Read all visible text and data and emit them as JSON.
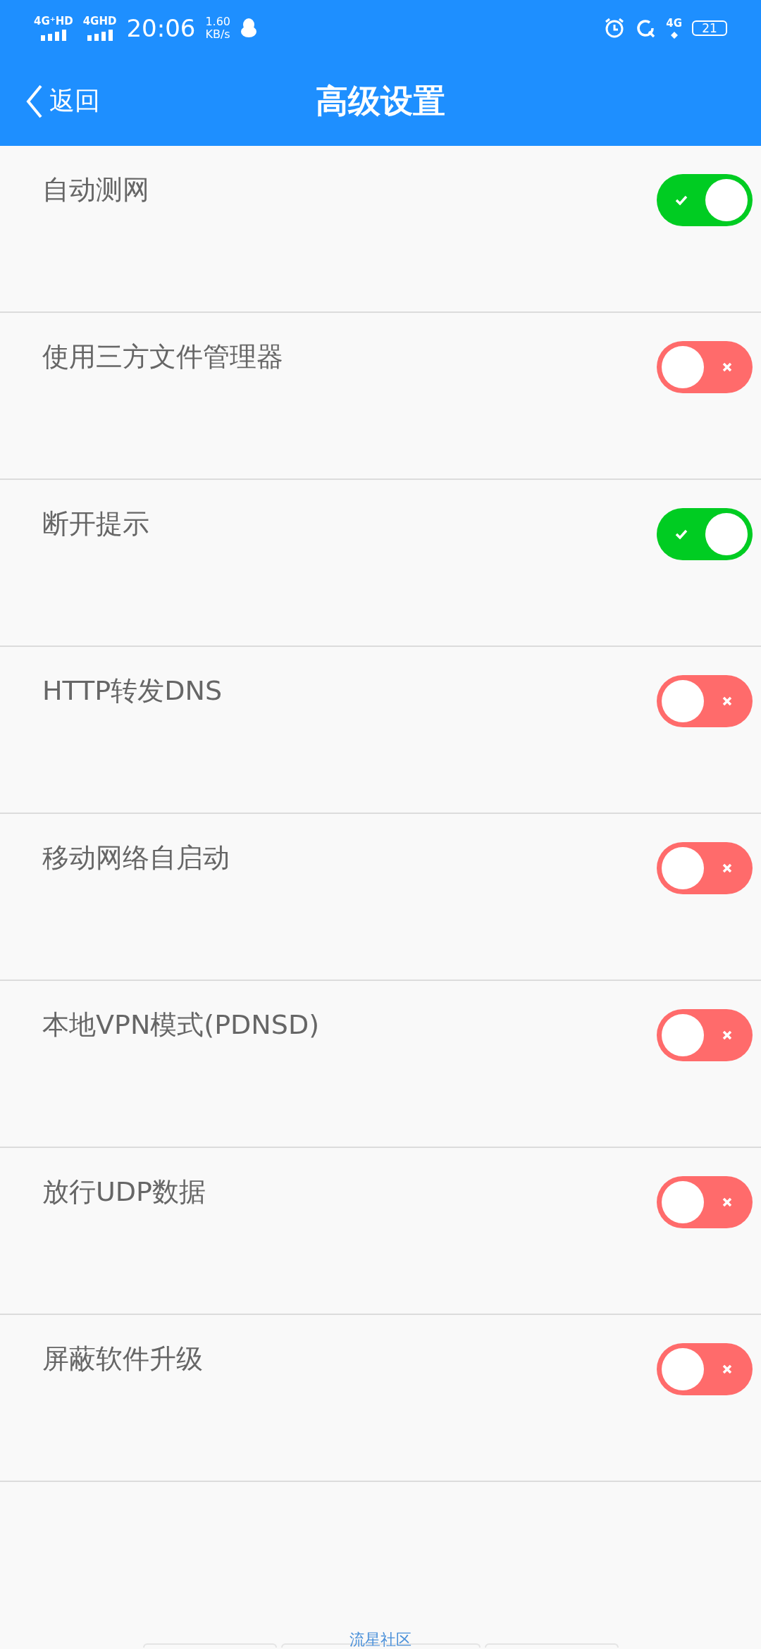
{
  "status_bar": {
    "signal_1": "4G⁺HD",
    "signal_2": "4GHD",
    "time": "20:06",
    "speed": "1.60",
    "speed_unit": "KB/s",
    "network": "4G",
    "battery": "21"
  },
  "header": {
    "back": "返回",
    "title": "高级设置"
  },
  "settings": [
    {
      "label": "自动测网",
      "on": true
    },
    {
      "label": "使用三方文件管理器",
      "on": false
    },
    {
      "label": "断开提示",
      "on": true
    },
    {
      "label": "HTTP转发DNS",
      "on": false
    },
    {
      "label": "移动网络自启动",
      "on": false
    },
    {
      "label": "本地VPN模式(PDNSD)",
      "on": false
    },
    {
      "label": "放行UDP数据",
      "on": false
    },
    {
      "label": "屏蔽软件升级",
      "on": false
    }
  ],
  "footer": {
    "caption": "流星社区"
  }
}
